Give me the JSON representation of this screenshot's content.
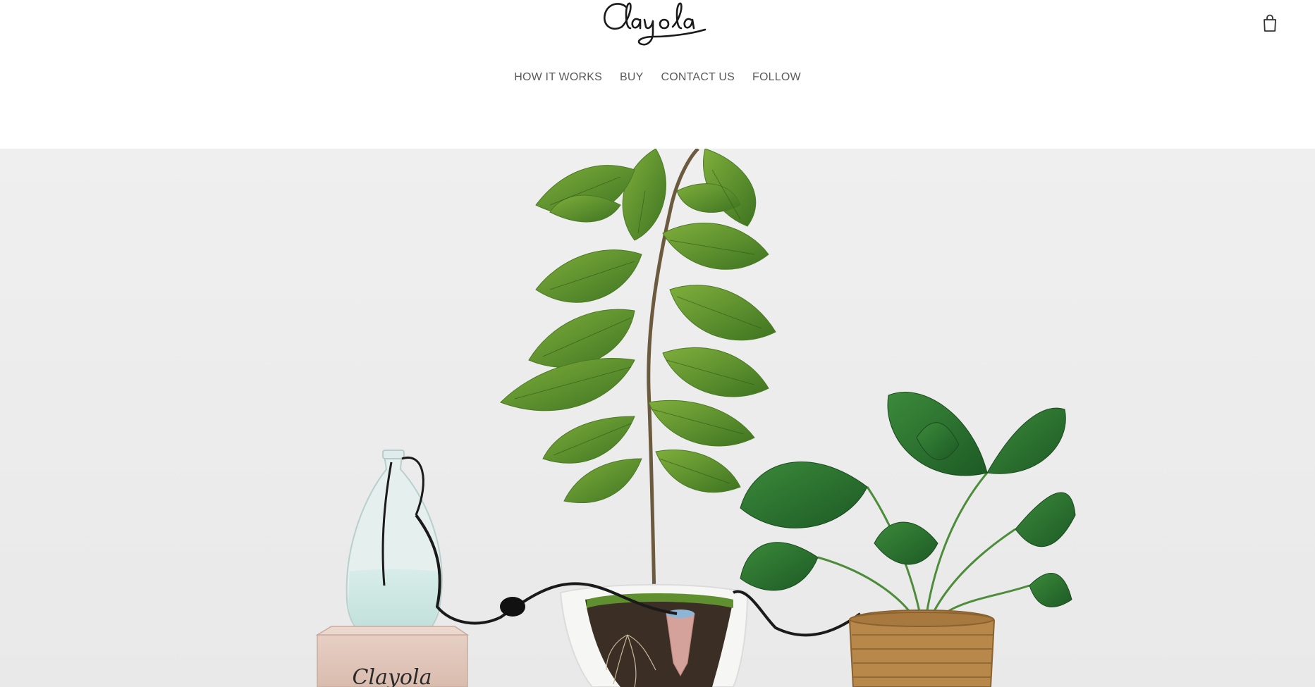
{
  "brand": {
    "logo_text": "Clayola",
    "logo_color": "#1a1a1a"
  },
  "header": {
    "cart_icon": "shopping-bag-icon"
  },
  "nav": {
    "items": [
      {
        "label": "HOW IT WORKS"
      },
      {
        "label": "BUY"
      },
      {
        "label": "CONTACT US"
      },
      {
        "label": "FOLLOW"
      }
    ],
    "color": "#5a5a5a"
  },
  "hero": {
    "background": "#ededed",
    "box_text": "Clayola"
  }
}
